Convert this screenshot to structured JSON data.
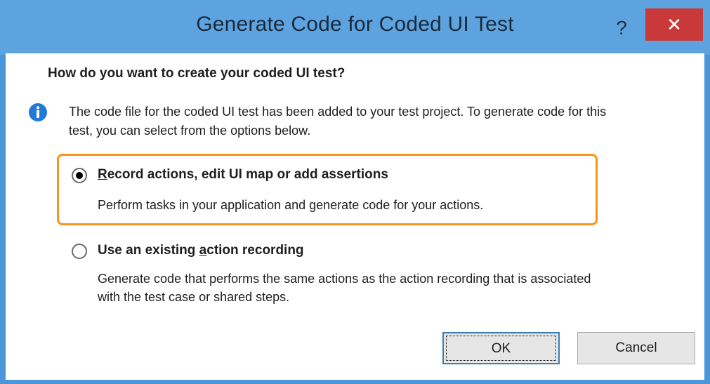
{
  "dialog": {
    "title": "Generate Code for Coded UI Test",
    "help_label": "?",
    "close_label": "✕"
  },
  "content": {
    "question": "How do you want to create your coded UI test?",
    "info_text": "The code file for the coded UI test has been added to your test project. To generate code for this test, you can select from the options below."
  },
  "options": [
    {
      "label_prefix": "R",
      "label_rest": "ecord actions, edit UI map or add assertions",
      "description": "Perform tasks in your application and generate code for your actions.",
      "selected": true
    },
    {
      "label_before": "Use an existing ",
      "label_underlined": "a",
      "label_after": "ction recording",
      "description": "Generate code that performs the same actions as the action recording that is associated with the test case or shared steps.",
      "selected": false
    }
  ],
  "buttons": {
    "ok": "OK",
    "cancel": "Cancel"
  },
  "colors": {
    "titlebar": "#5da3e0",
    "close": "#c9393a",
    "highlight": "#f7941d",
    "info_icon": "#1e7ad6"
  }
}
